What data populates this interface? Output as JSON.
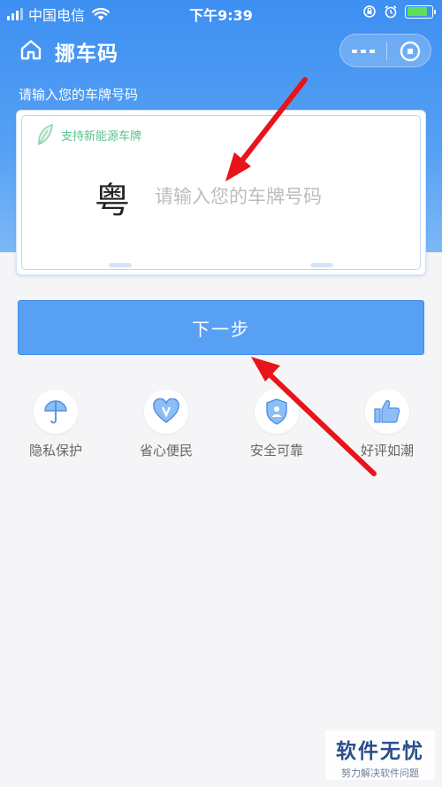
{
  "status_bar": {
    "carrier": "中国电信",
    "time": "下午9:39",
    "battery_level": 0.85
  },
  "nav": {
    "title": "挪车码",
    "icons": [
      "home-icon",
      "more-icon",
      "close-icon"
    ]
  },
  "form": {
    "prompt": "请输入您的车牌号码",
    "new_energy_label": "支持新能源车牌",
    "province": "粤",
    "plate_placeholder": "请输入您的车牌号码",
    "plate_value": ""
  },
  "next_button": {
    "label": "下一步"
  },
  "features": [
    {
      "icon": "umbrella-icon",
      "label": "隐私保护"
    },
    {
      "icon": "heart-v-icon",
      "label": "省心便民"
    },
    {
      "icon": "shield-icon",
      "label": "安全可靠"
    },
    {
      "icon": "thumbs-up-icon",
      "label": "好评如潮"
    }
  ],
  "watermark": {
    "title": "软件无忧",
    "subtitle": "努力解决软件问题"
  },
  "colors": {
    "header_blue": "#3d8ff2",
    "button_blue": "#58a0f3",
    "new_energy_green": "#59c28c",
    "annotation_red": "#e8141b"
  }
}
